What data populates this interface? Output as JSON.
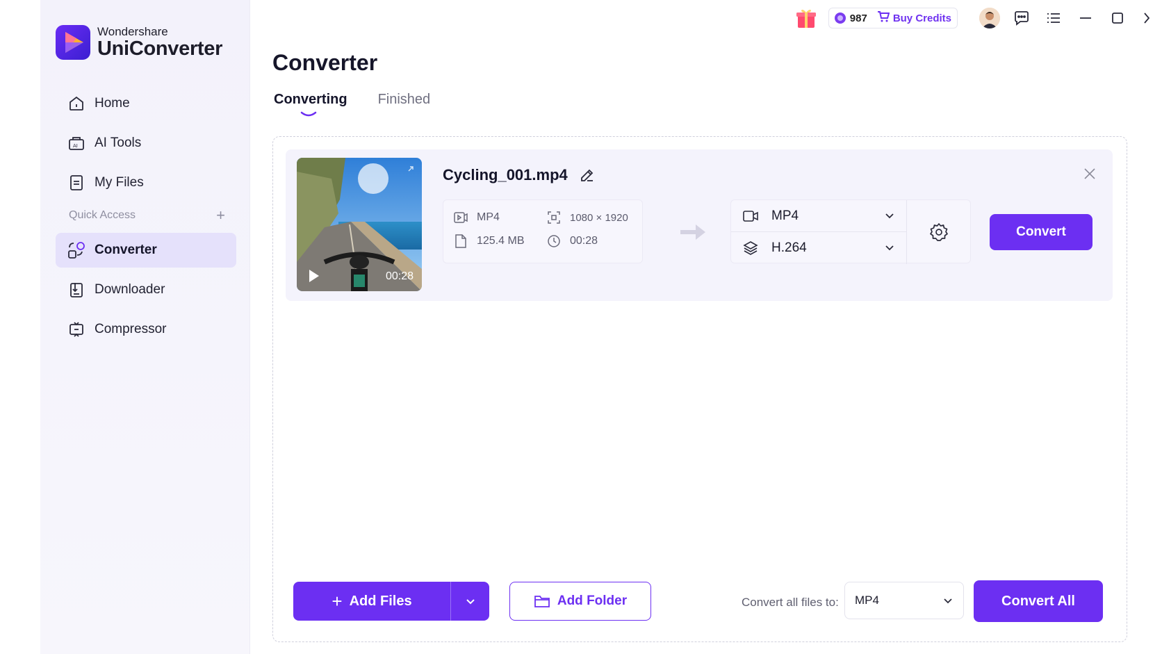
{
  "brand": {
    "company": "Wondershare",
    "product": "UniConverter"
  },
  "topbar": {
    "credits_count": "987",
    "buy_credits_label": "Buy Credits",
    "icons": [
      "gift-icon",
      "coin-icon",
      "cart-icon",
      "avatar",
      "chat-icon",
      "menu-icon",
      "minimize-icon",
      "maximize-icon",
      "more-icon"
    ]
  },
  "sidebar": {
    "items": [
      {
        "label": "Home",
        "icon": "home-icon"
      },
      {
        "label": "AI Tools",
        "icon": "ai-tools-icon"
      },
      {
        "label": "My Files",
        "icon": "my-files-icon"
      }
    ],
    "quick_access_label": "Quick Access",
    "quick_items": [
      {
        "label": "Converter",
        "icon": "converter-icon",
        "active": true
      },
      {
        "label": "Downloader",
        "icon": "downloader-icon"
      },
      {
        "label": "Compressor",
        "icon": "compressor-icon"
      }
    ]
  },
  "main": {
    "title": "Converter",
    "tabs": [
      {
        "label": "Converting",
        "active": true
      },
      {
        "label": "Finished",
        "active": false
      }
    ]
  },
  "file": {
    "name": "Cycling_001.mp4",
    "thumb_duration": "00:28",
    "format": "MP4",
    "resolution": "1080 × 1920",
    "size": "125.4 MB",
    "duration": "00:28",
    "output_format": "MP4",
    "output_codec": "H.264",
    "convert_label": "Convert"
  },
  "footer": {
    "add_files_label": "Add Files",
    "add_folder_label": "Add Folder",
    "convert_all_to_label": "Convert all files to:",
    "convert_all_format": "MP4",
    "convert_all_label": "Convert All"
  },
  "colors": {
    "accent": "#6c2ff2",
    "active_nav_bg": "#e5e1fb",
    "sidebar_bg": "#f3f2fb",
    "card_bg": "#f4f3fc"
  }
}
